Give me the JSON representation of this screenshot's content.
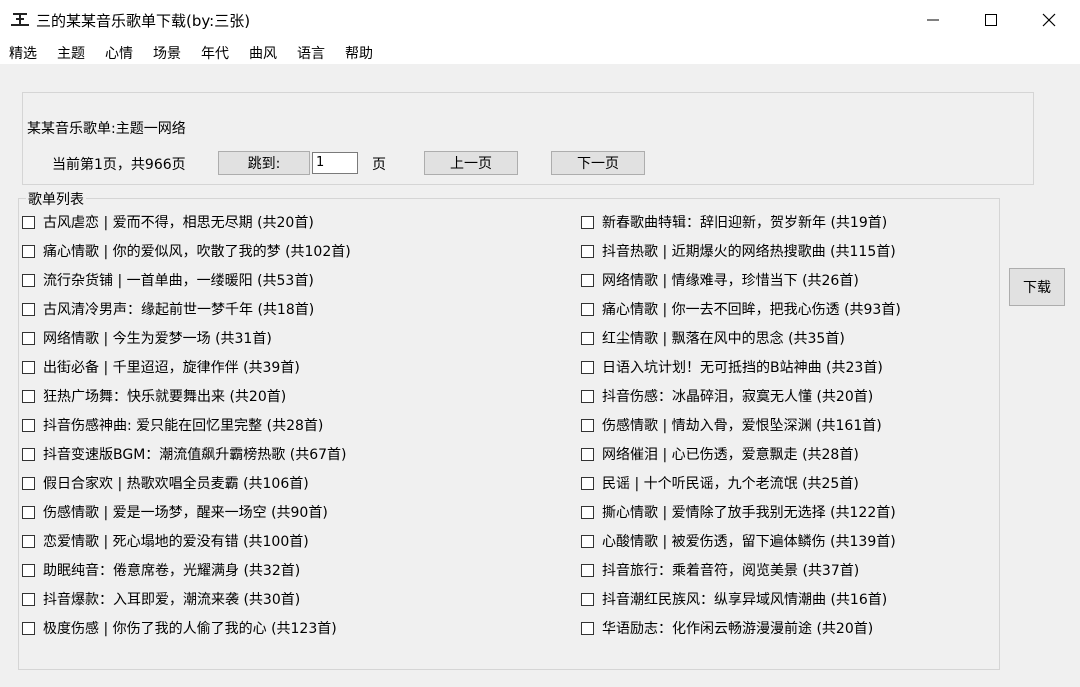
{
  "window": {
    "title": "三的某某音乐歌单下载(by:三张)"
  },
  "menu": [
    "精选",
    "主题",
    "心情",
    "场景",
    "年代",
    "曲风",
    "语言",
    "帮助"
  ],
  "header": {
    "subtitle": "某某音乐歌单:主题一网络",
    "page_info": "当前第1页，共966页",
    "jump_label": "跳到:",
    "page_input": "1",
    "page_unit": "页",
    "prev_label": "上一页",
    "next_label": "下一页"
  },
  "list": {
    "label": "歌单列表",
    "left": [
      "古风虐恋 | 爱而不得，相思无尽期 (共20首)",
      "痛心情歌 | 你的爱似风，吹散了我的梦 (共102首)",
      "流行杂货铺 | 一首单曲，一缕暖阳 (共53首)",
      "古风清冷男声：缘起前世一梦千年 (共18首)",
      "网络情歌 | 今生为爱梦一场 (共31首)",
      "出街必备 | 千里迢迢，旋律作伴 (共39首)",
      "狂热广场舞：快乐就要舞出来 (共20首)",
      "抖音伤感神曲: 爱只能在回忆里完整 (共28首)",
      "抖音变速版BGM：潮流值飙升霸榜热歌 (共67首)",
      "假日合家欢 | 热歌欢唱全员麦霸 (共106首)",
      "伤感情歌 | 爱是一场梦，醒来一场空 (共90首)",
      "恋爱情歌 | 死心塌地的爱没有错 (共100首)",
      "助眠纯音：倦意席卷，光耀满身 (共32首)",
      "抖音爆款：入耳即爱，潮流来袭 (共30首)",
      "极度伤感 | 你伤了我的人偷了我的心 (共123首)"
    ],
    "right": [
      "新春歌曲特辑：辞旧迎新，贺岁新年 (共19首)",
      "抖音热歌 | 近期爆火的网络热搜歌曲 (共115首)",
      "网络情歌 | 情缘难寻，珍惜当下 (共26首)",
      "痛心情歌 | 你一去不回眸，把我心伤透 (共93首)",
      "红尘情歌 | 飘落在风中的思念 (共35首)",
      "日语入坑计划！无可抵挡的B站神曲 (共23首)",
      "抖音伤感：冰晶碎泪，寂寞无人懂 (共20首)",
      "伤感情歌 | 情劫入骨，爱恨坠深渊 (共161首)",
      "网络催泪 | 心已伤透，爱意飘走 (共28首)",
      "民谣 | 十个听民谣，九个老流氓 (共25首)",
      "撕心情歌 | 爱情除了放手我别无选择 (共122首)",
      "心酸情歌 | 被爱伤透，留下遍体鳞伤 (共139首)",
      "抖音旅行：乘着音符，阅览美景 (共37首)",
      "抖音潮红民族风：纵享异域风情潮曲 (共16首)",
      "华语励志：化作闲云畅游漫漫前途 (共20首)"
    ]
  },
  "download_label": "下载"
}
